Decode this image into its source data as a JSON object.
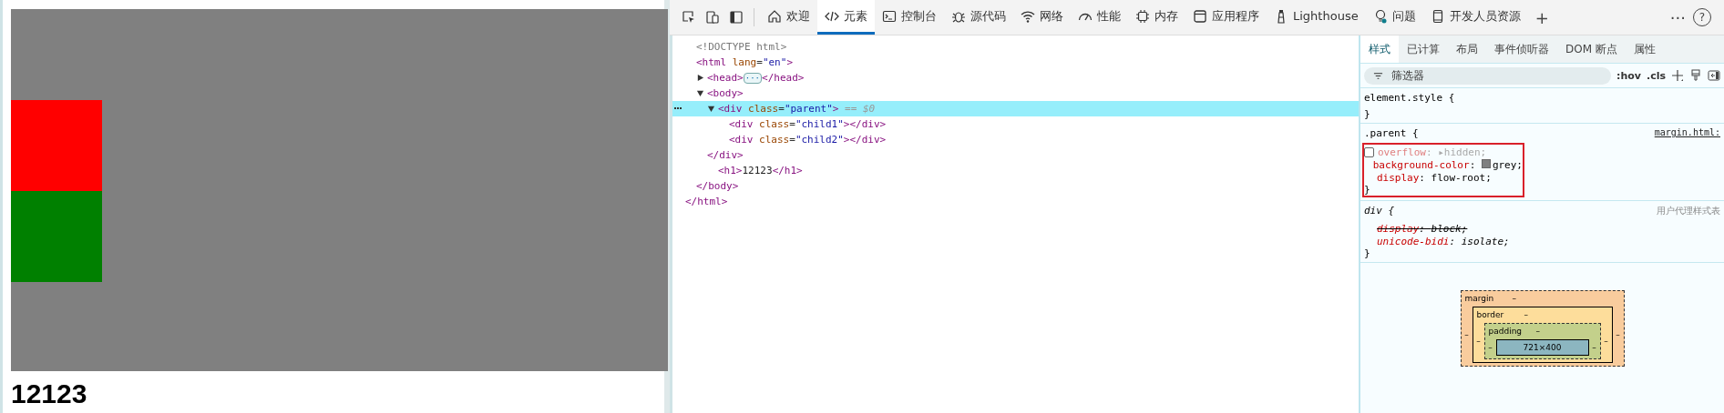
{
  "page": {
    "blocks": [
      {
        "kind": "parent",
        "color": "#808080"
      },
      {
        "kind": "child",
        "color": "#ff0000"
      },
      {
        "kind": "child",
        "color": "#008000"
      }
    ],
    "heading": "12123"
  },
  "toolbar": {
    "tabs": [
      {
        "label": "欢迎",
        "selected": false
      },
      {
        "label": "元素",
        "selected": true
      },
      {
        "label": "控制台",
        "selected": false
      },
      {
        "label": "源代码",
        "selected": false
      },
      {
        "label": "网络",
        "selected": false
      },
      {
        "label": "性能",
        "selected": false
      },
      {
        "label": "内存",
        "selected": false
      },
      {
        "label": "应用程序",
        "selected": false
      },
      {
        "label": "Lighthouse",
        "selected": false
      },
      {
        "label": "问题",
        "selected": false
      },
      {
        "label": "开发人员资源",
        "selected": false
      }
    ],
    "add": "+",
    "more": "···",
    "help": "?"
  },
  "dom_tree": [
    {
      "tokens": [
        {
          "kind": "doctype",
          "text": "<!DOCTYPE html>"
        }
      ],
      "selected": false
    },
    {
      "tokens": [
        {
          "kind": "tag",
          "text": "<html"
        },
        {
          "kind": "attr",
          "text": " lang"
        },
        {
          "kind": "punct",
          "text": "="
        },
        {
          "kind": "value",
          "text": "\"en\""
        },
        {
          "kind": "tag",
          "text": ">"
        }
      ],
      "selected": false,
      "closing": "</html>",
      "children": [
        {
          "tokens": [
            {
              "kind": "tag",
              "text": "<head>"
            },
            {
              "kind": "ellipsis",
              "text": "···"
            },
            {
              "kind": "tag",
              "text": "</head>"
            }
          ],
          "expanded": false,
          "selected": false
        },
        {
          "tokens": [
            {
              "kind": "tag",
              "text": "<body>"
            }
          ],
          "expanded": true,
          "selected": false,
          "closing": "</body>",
          "children": [
            {
              "tokens": [
                {
                  "kind": "tag",
                  "text": "<div"
                },
                {
                  "kind": "attr",
                  "text": " class"
                },
                {
                  "kind": "punct",
                  "text": "="
                },
                {
                  "kind": "value",
                  "text": "\"parent\""
                },
                {
                  "kind": "tag",
                  "text": ">"
                },
                {
                  "kind": "ref",
                  "text": " == $0"
                }
              ],
              "expanded": true,
              "selected": true,
              "closing": "</div>",
              "children": [
                {
                  "tokens": [
                    {
                      "kind": "tag",
                      "text": "<div"
                    },
                    {
                      "kind": "attr",
                      "text": " class"
                    },
                    {
                      "kind": "punct",
                      "text": "="
                    },
                    {
                      "kind": "value",
                      "text": "\"child1\""
                    },
                    {
                      "kind": "tag",
                      "text": "></div>"
                    }
                  ],
                  "selected": false
                },
                {
                  "tokens": [
                    {
                      "kind": "tag",
                      "text": "<div"
                    },
                    {
                      "kind": "attr",
                      "text": " class"
                    },
                    {
                      "kind": "punct",
                      "text": "="
                    },
                    {
                      "kind": "value",
                      "text": "\"child2\""
                    },
                    {
                      "kind": "tag",
                      "text": "></div>"
                    }
                  ],
                  "selected": false
                }
              ]
            },
            {
              "tokens": [
                {
                  "kind": "tag",
                  "text": "<h1>"
                },
                {
                  "kind": "text",
                  "text": "12123"
                },
                {
                  "kind": "tag",
                  "text": "</h1>"
                }
              ],
              "selected": false
            }
          ]
        }
      ]
    }
  ],
  "styles_tabs": [
    {
      "label": "样式",
      "selected": true
    },
    {
      "label": "已计算",
      "selected": false
    },
    {
      "label": "布局",
      "selected": false
    },
    {
      "label": "事件侦听器",
      "selected": false
    },
    {
      "label": "DOM 断点",
      "selected": false
    },
    {
      "label": "属性",
      "selected": false
    }
  ],
  "filter": {
    "placeholder": "筛选器",
    "hov": ":hov",
    "cls": ".cls"
  },
  "rules": [
    {
      "kind": "inline",
      "selector": "element.style {",
      "highlighted": false,
      "close": "}"
    },
    {
      "kind": "author",
      "selector": ".parent {",
      "source": "margin.html:",
      "highlighted": true,
      "declarations": [
        {
          "property": "overflow",
          "colon": ":",
          "arrow": "▸",
          "value": "hidden;",
          "enabled": false,
          "struck": false
        },
        {
          "property": "background-color",
          "colon": ":",
          "value": "grey;",
          "color": "#808080",
          "enabled": true,
          "struck": false
        },
        {
          "property": "display",
          "colon": ":",
          "value": "flow-root;",
          "enabled": true,
          "struck": false
        }
      ],
      "close": "}"
    },
    {
      "kind": "user_agent",
      "selector": "div {",
      "source": "用户代理样式表",
      "highlighted": false,
      "declarations": [
        {
          "property": "display",
          "colon": ":",
          "value": "block;",
          "enabled": true,
          "struck": true
        },
        {
          "property": "unicode-bidi",
          "colon": ":",
          "value": "isolate;",
          "enabled": true,
          "struck": false
        }
      ],
      "close": "}"
    }
  ],
  "box_model": {
    "margin": {
      "label": "margin",
      "top": "–",
      "left": "–",
      "right": "–"
    },
    "border": {
      "label": "border",
      "top": "–",
      "left": "–",
      "right": "–"
    },
    "padding": {
      "label": "padding",
      "top": "–",
      "left": "–",
      "right": "–"
    },
    "content": "721×400"
  }
}
